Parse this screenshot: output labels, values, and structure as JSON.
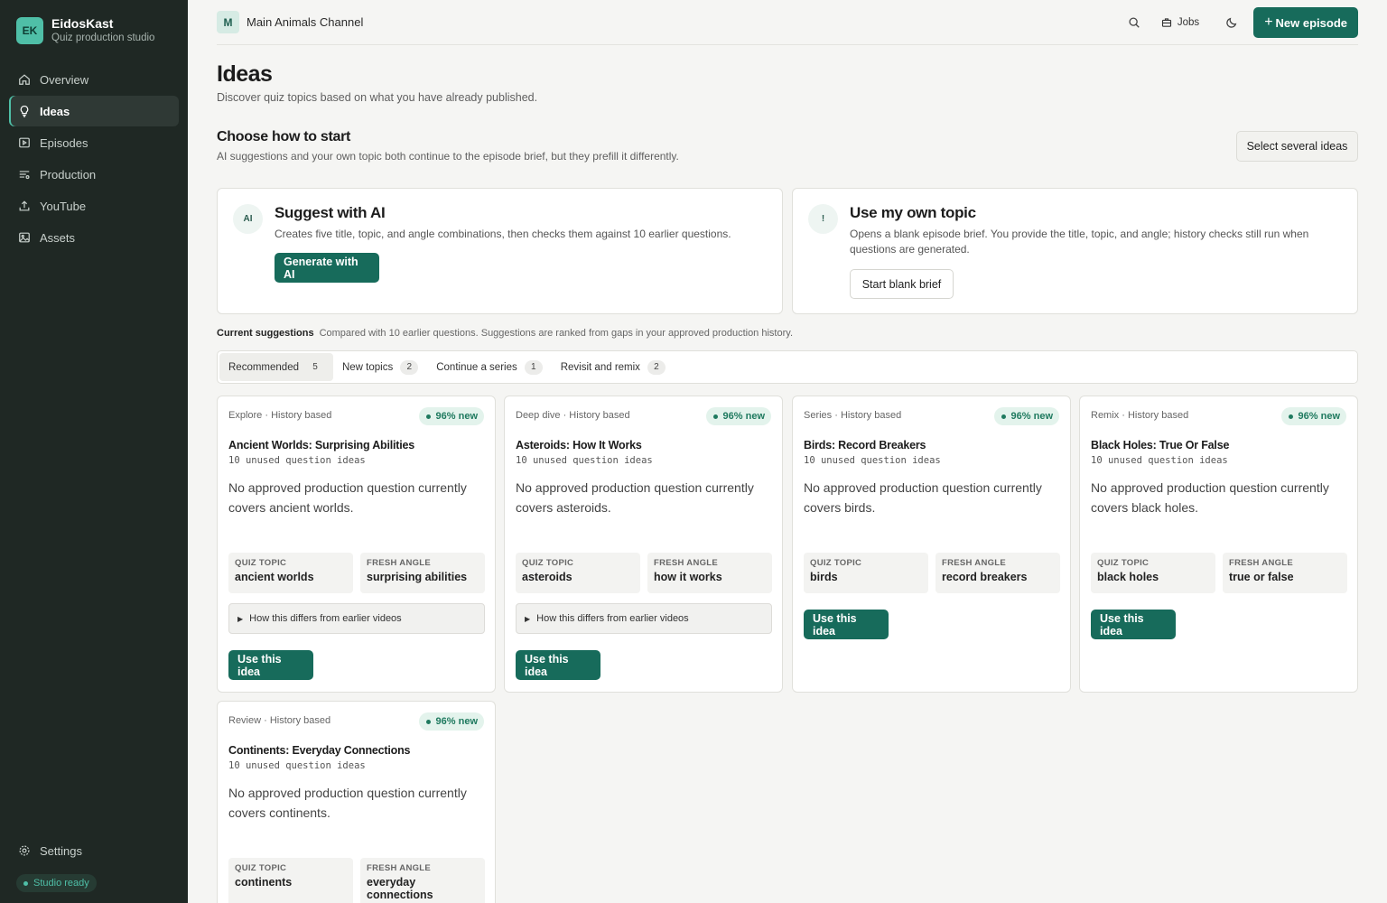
{
  "brand": {
    "initials": "EK",
    "name": "EidosKast",
    "subtitle": "Quiz production studio"
  },
  "sidebar": {
    "items": [
      {
        "label": "Overview",
        "icon": "home-icon",
        "active": false
      },
      {
        "label": "Ideas",
        "icon": "lightbulb-icon",
        "active": true
      },
      {
        "label": "Episodes",
        "icon": "episodes-icon",
        "active": false
      },
      {
        "label": "Production",
        "icon": "sliders-icon",
        "active": false
      },
      {
        "label": "YouTube",
        "icon": "upload-icon",
        "active": false
      },
      {
        "label": "Assets",
        "icon": "image-icon",
        "active": false
      }
    ],
    "settings_label": "Settings",
    "status": "Studio ready"
  },
  "topbar": {
    "channel_initial": "M",
    "channel_name": "Main Animals Channel",
    "jobs_label": "Jobs",
    "new_episode_label": "New episode"
  },
  "page": {
    "title": "Ideas",
    "subtitle": "Discover quiz topics based on what you have already published."
  },
  "start": {
    "title": "Choose how to start",
    "subtitle": "AI suggestions and your own topic both continue to the episode brief, but they prefill it differently.",
    "select_several_label": "Select several ideas",
    "ai": {
      "badge": "AI",
      "title": "Suggest with AI",
      "description": "Creates five title, topic, and angle combinations, then checks them against 10 earlier questions.",
      "button": "Generate with AI"
    },
    "own": {
      "badge": "!",
      "title": "Use my own topic",
      "description": "Opens a blank episode brief. You provide the title, topic, and angle; history checks still run when questions are generated.",
      "button": "Start blank brief"
    }
  },
  "suggestions": {
    "label": "Current suggestions",
    "note": "Compared with 10 earlier questions. Suggestions are ranked from gaps in your approved production history.",
    "tabs": [
      {
        "label": "Recommended",
        "count": "5",
        "active": true
      },
      {
        "label": "New topics",
        "count": "2",
        "active": false
      },
      {
        "label": "Continue a series",
        "count": "1",
        "active": false
      },
      {
        "label": "Revisit and remix",
        "count": "2",
        "active": false
      }
    ],
    "chip_topic_label": "QUIZ TOPIC",
    "chip_angle_label": "FRESH ANGLE",
    "details_label": "How this differs from earlier videos",
    "use_label": "Use this idea",
    "cards": [
      {
        "meta": "Explore · History based",
        "score": "96% new",
        "title": "Ancient Worlds: Surprising Abilities",
        "unused": "10 unused question ideas",
        "description": "No approved production question currently covers ancient worlds.",
        "topic": "ancient worlds",
        "angle": "surprising abilities",
        "has_details": true
      },
      {
        "meta": "Deep dive · History based",
        "score": "96% new",
        "title": "Asteroids: How It Works",
        "unused": "10 unused question ideas",
        "description": "No approved production question currently covers asteroids.",
        "topic": "asteroids",
        "angle": "how it works",
        "has_details": true
      },
      {
        "meta": "Series · History based",
        "score": "96% new",
        "title": "Birds: Record Breakers",
        "unused": "10 unused question ideas",
        "description": "No approved production question currently covers birds.",
        "topic": "birds",
        "angle": "record breakers",
        "has_details": false
      },
      {
        "meta": "Remix · History based",
        "score": "96% new",
        "title": "Black Holes: True Or False",
        "unused": "10 unused question ideas",
        "description": "No approved production question currently covers black holes.",
        "topic": "black holes",
        "angle": "true or false",
        "has_details": false
      },
      {
        "meta": "Review · History based",
        "score": "96% new",
        "title": "Continents: Everyday Connections",
        "unused": "10 unused question ideas",
        "description": "No approved production question currently covers continents.",
        "topic": "continents",
        "angle": "everyday connections",
        "has_details": false
      }
    ]
  },
  "colors": {
    "accent": "#176b5b",
    "sidebar_bg": "#1f2824",
    "badge_mint": "#4fbfa7",
    "pill_bg": "#e3f3ec"
  }
}
